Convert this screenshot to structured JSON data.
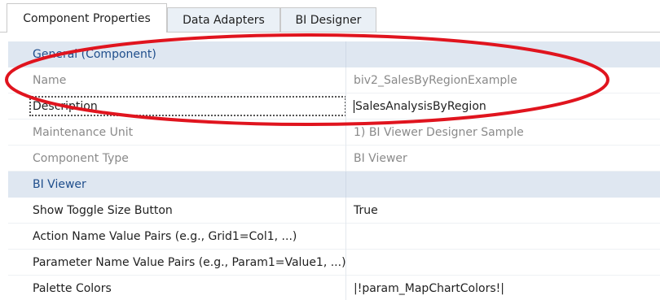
{
  "tabs": [
    {
      "label": "Component Properties",
      "active": true
    },
    {
      "label": "Data Adapters",
      "active": false
    },
    {
      "label": "BI Designer",
      "active": false
    }
  ],
  "grid": {
    "categories": [
      {
        "label": "General (Component)",
        "rows": [
          {
            "name": "Name",
            "value": "biv2_SalesByRegionExample",
            "readonly": true
          },
          {
            "name": "Description",
            "value": "SalesAnalysisByRegion",
            "readonly": false,
            "focused": true
          },
          {
            "name": "Maintenance Unit",
            "value": "1) BI Viewer Designer Sample",
            "readonly": true
          },
          {
            "name": "Component Type",
            "value": "BI Viewer",
            "readonly": true
          }
        ]
      },
      {
        "label": "BI Viewer",
        "rows": [
          {
            "name": "Show Toggle Size Button",
            "value": "True",
            "readonly": false
          },
          {
            "name": "Action Name Value Pairs (e.g., Grid1=Col1, ...)",
            "value": "",
            "readonly": false
          },
          {
            "name": "Parameter Name Value Pairs (e.g., Param1=Value1, ...)",
            "value": "",
            "readonly": false
          },
          {
            "name": "Palette Colors",
            "value": "|!param_MapChartColors!|",
            "readonly": false
          }
        ]
      }
    ]
  },
  "colors": {
    "category_bg": "#dfe7f1",
    "category_text": "#1f4e8c",
    "readonly_text": "#8a8a8a",
    "annotation": "#e0141e"
  },
  "icons": {
    "expander": "minus-box-icon"
  }
}
